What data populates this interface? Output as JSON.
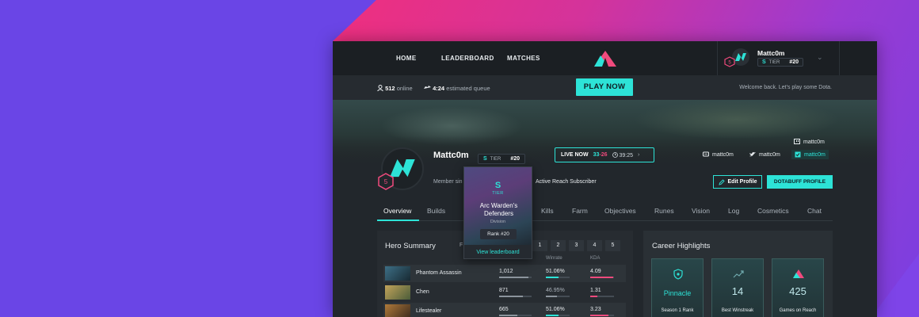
{
  "nav": {
    "links": [
      "HOME",
      "LEADERBOARD",
      "MATCHES"
    ],
    "user": {
      "name": "Mattc0m",
      "tier_letter": "S",
      "tier_label": "TIER",
      "rank": "#20",
      "level": "5"
    }
  },
  "status": {
    "online_count": "512",
    "online_label": "online",
    "queue_time": "4:24",
    "queue_label": "estimated queue",
    "play_label": "PLAY NOW",
    "welcome": "Welcome back. Let's play some Dota."
  },
  "profile": {
    "name": "Mattc0m",
    "tier_letter": "S",
    "tier_label": "TIER",
    "rank": "#20",
    "level": "5",
    "member_since": "Member sin",
    "reach": "Active Reach Subscriber",
    "edit_label": "Edit Profile",
    "subscriber_label": "DOTABUFF PROFILE"
  },
  "live": {
    "label": "LIVE NOW",
    "score_a": "33",
    "dash": "-",
    "score_b": "26",
    "clock": "39:25"
  },
  "socials": {
    "twitch_name": "mattc0m",
    "discord_name": "mattc0m",
    "twitter_name": "mattc0m",
    "steam_name": "mattc0m"
  },
  "tabs": [
    "Overview",
    "Builds",
    "Kills",
    "Farm",
    "Objectives",
    "Runes",
    "Vision",
    "Log",
    "Cosmetics",
    "Chat"
  ],
  "hero_summary": {
    "title": "Hero Summary",
    "filter_initial": "F",
    "pages": [
      "1",
      "2",
      "3",
      "4",
      "5"
    ],
    "columns": [
      "Winrate",
      "KDA"
    ],
    "rows": [
      {
        "name": "Phantom Assassin",
        "matches": "1,012",
        "matches_frac": 0.9,
        "winrate": "51.06%",
        "winrate_frac": 0.52,
        "kda": "4.09",
        "kda_frac": 0.95
      },
      {
        "name": "Chen",
        "matches": "871",
        "matches_frac": 0.72,
        "winrate": "46.95%",
        "winrate_frac": 0.47,
        "kda": "1.31",
        "kda_frac": 0.3
      },
      {
        "name": "Lifestealer",
        "matches": "665",
        "matches_frac": 0.55,
        "winrate": "51.06%",
        "winrate_frac": 0.52,
        "kda": "3.23",
        "kda_frac": 0.75
      }
    ]
  },
  "career": {
    "title": "Career Highlights",
    "cards": [
      {
        "value": "Pinnacle",
        "label": "Season 1 Rank",
        "icon": "shield-icon"
      },
      {
        "value": "14",
        "label": "Best Winstreak",
        "icon": "trend-icon"
      },
      {
        "value": "425",
        "label": "Games on Reach",
        "icon": "reach-logo-icon"
      }
    ]
  },
  "tooltip": {
    "tier_letter": "S",
    "tier_label": "TIER",
    "team": "Arc Warden's Defenders",
    "division": "Division",
    "rank": "Rank #20",
    "link": "View leaderboard"
  },
  "colors": {
    "accent": "#2de3d7",
    "pink": "#f04a7d",
    "bg": "#22272c",
    "brand_purple": "#6a45e6"
  }
}
